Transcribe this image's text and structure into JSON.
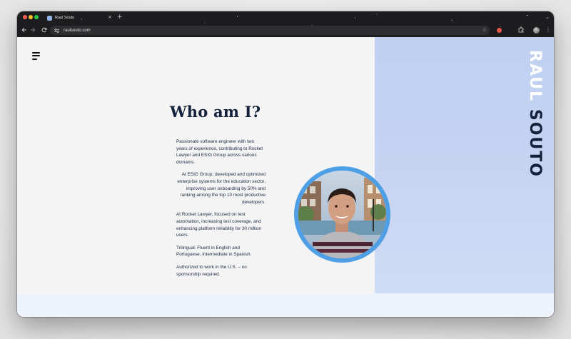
{
  "browser": {
    "tab": {
      "title": "Raul Souto"
    },
    "new_tab_glyph": "+",
    "tab_close_glyph": "×",
    "tab_menu_glyph": "⌄",
    "url": "raulsouto.com",
    "icons": {
      "back": "arrow-left-icon",
      "forward": "arrow-right-icon",
      "reload": "reload-icon",
      "site_info": "tune-icon",
      "bookmark": "star-icon",
      "extension": "extension-icon",
      "profile": "profile-avatar",
      "menu": "kebab-menu-icon"
    }
  },
  "page": {
    "menu_icon": "hamburger-menu-icon",
    "brand": {
      "first": "RAUL",
      "last": "SOUTO"
    },
    "heading": "Who am I?",
    "bio": [
      "Passionate software engineer with two years of experience, contributing to Rocket Lawyer and ESIG Group across various domains.",
      "At ESIG Group, developed and optimized enterprise systems for the education sector, improving user onboarding by 50% and ranking among the top 10 most productive developers.",
      "At Rocket Lawyer, focused on test automation, increasing test coverage, and enhancing platform reliability for 30 million users.",
      "Trilingual: Fluent in English and Portuguese, Intermediate in Spanish.",
      "Authorized to work in the U.S. – no sponsorship required."
    ],
    "colors": {
      "accent_panel": "#c4d3f1",
      "navy": "#13213b",
      "avatar_ring": "#4f9fe6",
      "page_bg": "#f4f4f4"
    }
  }
}
